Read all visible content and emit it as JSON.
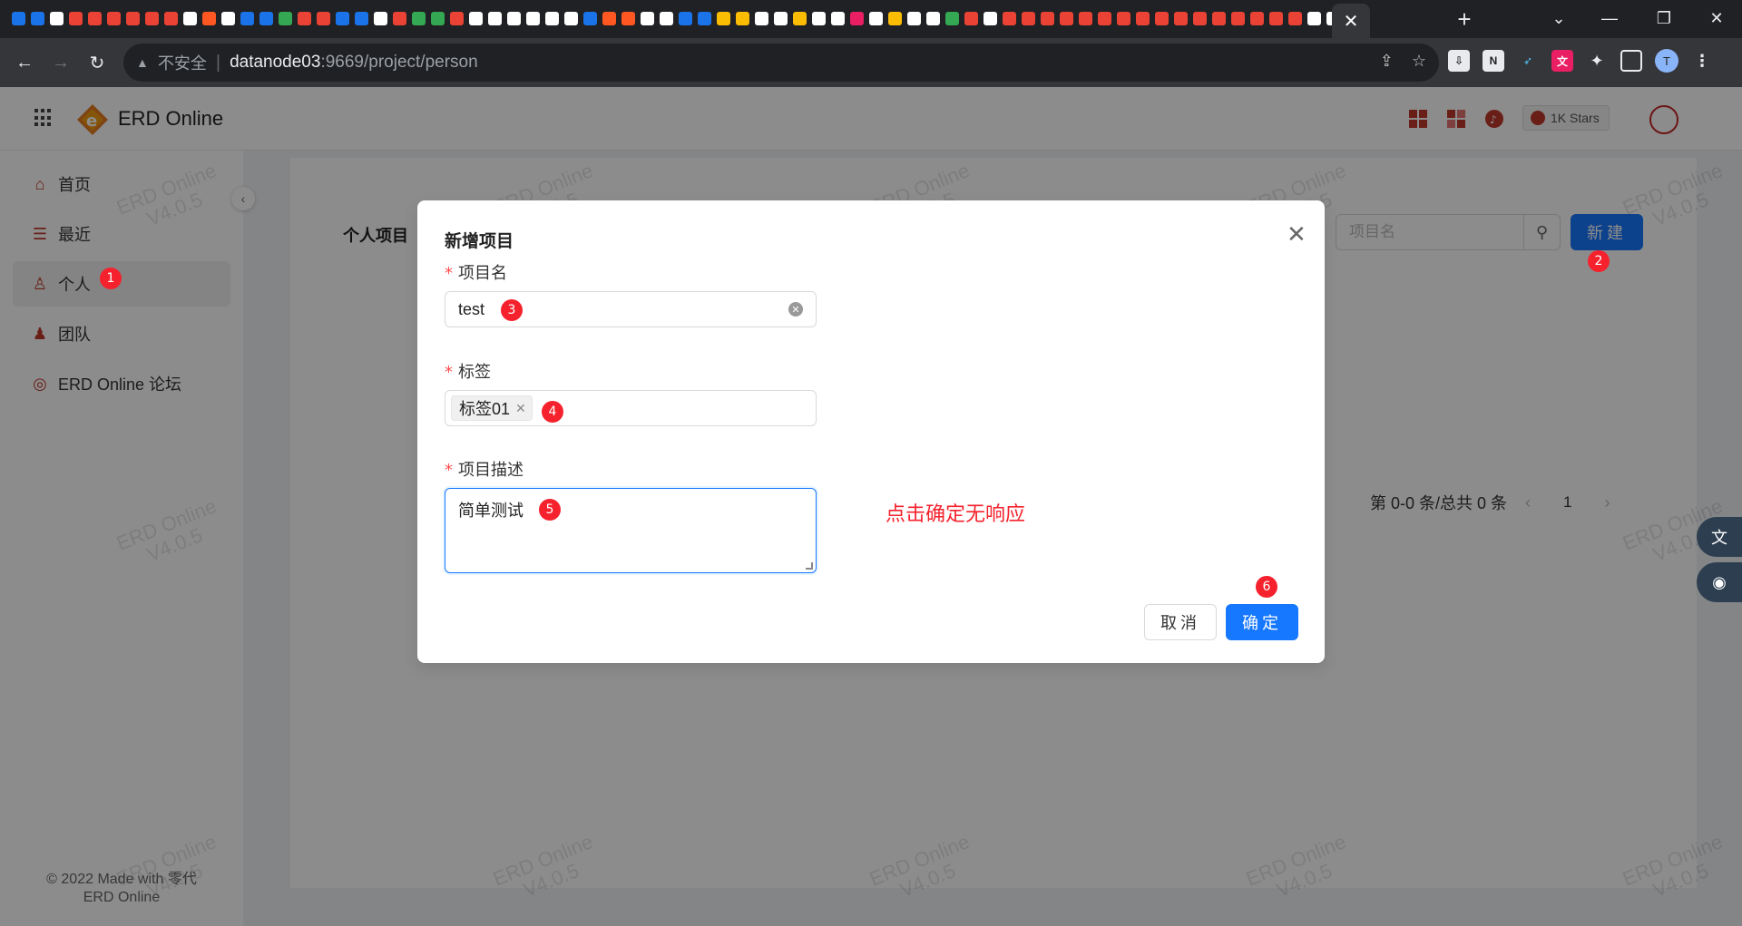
{
  "browser": {
    "favicon_colors": [
      "#1a73e8",
      "#1a73e8",
      "#ffffff",
      "#ea4335",
      "#ea4335",
      "#ea4335",
      "#ea4335",
      "#ea4335",
      "#ea4335",
      "#ffffff",
      "#ff5722",
      "#ffffff",
      "#1a73e8",
      "#1a73e8",
      "#34a853",
      "#ea4335",
      "#ea4335",
      "#1a73e8",
      "#1a73e8",
      "#ffffff",
      "#ea4335",
      "#34a853",
      "#34a853",
      "#ea4335",
      "#ffffff",
      "#ffffff",
      "#ffffff",
      "#ffffff",
      "#ffffff",
      "#ffffff",
      "#1a73e8",
      "#ff5722",
      "#ff5722",
      "#ffffff",
      "#ffffff",
      "#1a73e8",
      "#1a73e8",
      "#fbbc04",
      "#fbbc04",
      "#ffffff",
      "#ffffff",
      "#fbbc04",
      "#ffffff",
      "#ffffff",
      "#e91e63",
      "#ffffff",
      "#fbbc04",
      "#ffffff",
      "#ffffff",
      "#34a853",
      "#ea4335",
      "#ffffff",
      "#ea4335",
      "#ea4335",
      "#ea4335",
      "#ea4335",
      "#ea4335",
      "#ea4335",
      "#ea4335",
      "#ea4335",
      "#ea4335",
      "#ea4335",
      "#ea4335",
      "#ea4335",
      "#ea4335",
      "#ea4335",
      "#ea4335",
      "#ea4335",
      "#ffffff",
      "#ffffff",
      "#34a853",
      "#ffffff",
      "#ffffff"
    ],
    "active_tab_close": "✕",
    "new_tab": "+",
    "window_controls": [
      "⌄",
      "—",
      "❐",
      "✕"
    ],
    "insecure_label": "不安全",
    "url_host": "datanode03",
    "url_rest": ":9669/project/person",
    "profile_initial": "T"
  },
  "app": {
    "title": "ERD Online",
    "stars_label": "1K Stars"
  },
  "sidebar": {
    "items": [
      {
        "label": "首页",
        "icon": "home-icon"
      },
      {
        "label": "最近",
        "icon": "recent-icon"
      },
      {
        "label": "个人",
        "icon": "user-icon"
      },
      {
        "label": "团队",
        "icon": "team-icon"
      },
      {
        "label": "ERD Online 论坛",
        "icon": "globe-icon"
      }
    ],
    "footer_line1": "© 2022 Made with 零代",
    "footer_line2": "ERD Online"
  },
  "content": {
    "card_title": "个人项目",
    "search_placeholder": "项目名",
    "new_button": "新建",
    "pager_summary": "第 0-0 条/总共 0 条",
    "pager_page": "1"
  },
  "watermark": {
    "line1": "ERD Online",
    "line2": "V4.0.5"
  },
  "modal": {
    "title": "新增项目",
    "fields": {
      "name_label": "项目名",
      "name_value": "test",
      "tags_label": "标签",
      "tag_value": "标签01",
      "desc_label": "项目描述",
      "desc_value": "简单测试"
    },
    "note": "点击确定无响应",
    "cancel_label": "取消",
    "ok_label": "确定"
  },
  "annotations": [
    "1",
    "2",
    "3",
    "4",
    "5",
    "6"
  ]
}
